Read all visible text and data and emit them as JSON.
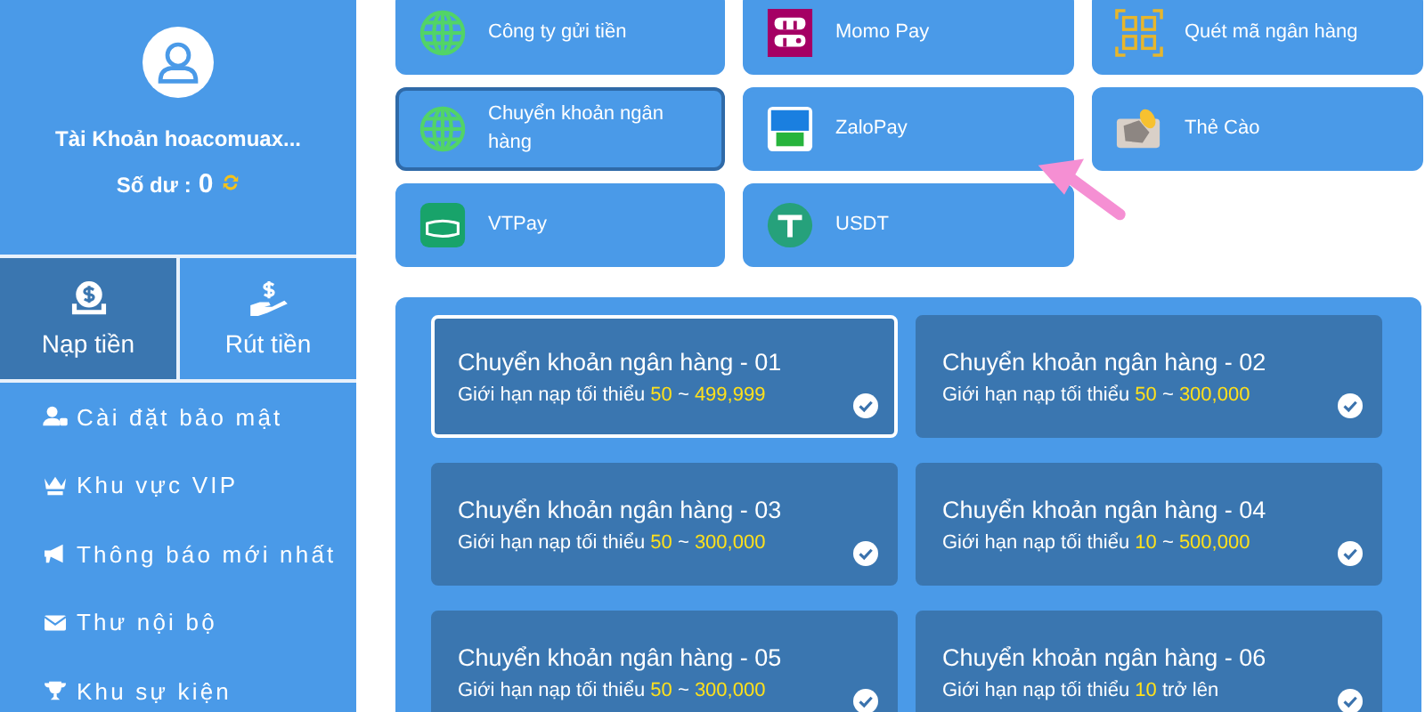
{
  "sidebar": {
    "account_name": "Tài Khoản hoacomuax...",
    "balance_label": "Số dư :",
    "balance": "0",
    "tabs": [
      {
        "label": "Nạp tiền",
        "kind": "deposit",
        "selected": true
      },
      {
        "label": "Rút tiền",
        "kind": "withdraw",
        "selected": false
      }
    ],
    "menu": [
      {
        "label": "Cài đặt bảo mật",
        "kind": "security"
      },
      {
        "label": "Khu vực VIP",
        "kind": "vip"
      },
      {
        "label": "Thông báo mới nhất",
        "kind": "notice"
      },
      {
        "label": "Thư nội bộ",
        "kind": "mail"
      },
      {
        "label": "Khu sự kiện",
        "kind": "trophy"
      }
    ]
  },
  "methods": [
    {
      "label": "Công ty gửi tiền",
      "kind": "globe",
      "selected": false
    },
    {
      "label": "Momo Pay",
      "kind": "momo",
      "selected": false
    },
    {
      "label": "Quét mã ngân hàng",
      "kind": "qr",
      "selected": false
    },
    {
      "label": "Chuyển khoản ngân hàng",
      "kind": "globe",
      "selected": true
    },
    {
      "label": "ZaloPay",
      "kind": "zalo",
      "selected": false
    },
    {
      "label": "Thẻ Cào",
      "kind": "card",
      "selected": false
    },
    {
      "label": "VTPay",
      "kind": "vtpay",
      "selected": false
    },
    {
      "label": "USDT",
      "kind": "usdt",
      "selected": false
    }
  ],
  "banks": [
    {
      "title": "Chuyển khoản ngân hàng - 01",
      "selected": true,
      "limit": [
        {
          "text": "Giới hạn nạp tối thiểu",
          "highlight": false
        },
        {
          "text": "50",
          "highlight": true
        },
        {
          "text": "~",
          "highlight": false
        },
        {
          "text": "499,999",
          "highlight": true
        }
      ]
    },
    {
      "title": "Chuyển khoản ngân hàng - 02",
      "selected": false,
      "limit": [
        {
          "text": "Giới hạn nạp tối thiểu",
          "highlight": false
        },
        {
          "text": "50",
          "highlight": true
        },
        {
          "text": "~",
          "highlight": false
        },
        {
          "text": "300,000",
          "highlight": true
        }
      ]
    },
    {
      "title": "Chuyển khoản ngân hàng - 03",
      "selected": false,
      "limit": [
        {
          "text": "Giới hạn nạp tối thiểu",
          "highlight": false
        },
        {
          "text": "50",
          "highlight": true
        },
        {
          "text": "~",
          "highlight": false
        },
        {
          "text": "300,000",
          "highlight": true
        }
      ]
    },
    {
      "title": "Chuyển khoản ngân hàng - 04",
      "selected": false,
      "limit": [
        {
          "text": "Giới hạn nạp tối thiểu",
          "highlight": false
        },
        {
          "text": "10",
          "highlight": true
        },
        {
          "text": "~",
          "highlight": false
        },
        {
          "text": "500,000",
          "highlight": true
        }
      ]
    },
    {
      "title": "Chuyển khoản ngân hàng - 05",
      "selected": false,
      "limit": [
        {
          "text": "Giới hạn nạp tối thiểu",
          "highlight": false
        },
        {
          "text": "50",
          "highlight": true
        },
        {
          "text": "~",
          "highlight": false
        },
        {
          "text": "300,000",
          "highlight": true
        }
      ]
    },
    {
      "title": "Chuyển khoản ngân hàng - 06",
      "selected": false,
      "limit": [
        {
          "text": "Giới hạn nạp tối thiểu",
          "highlight": false
        },
        {
          "text": "10",
          "highlight": true
        },
        {
          "text": "trở lên",
          "highlight": false
        }
      ]
    }
  ]
}
